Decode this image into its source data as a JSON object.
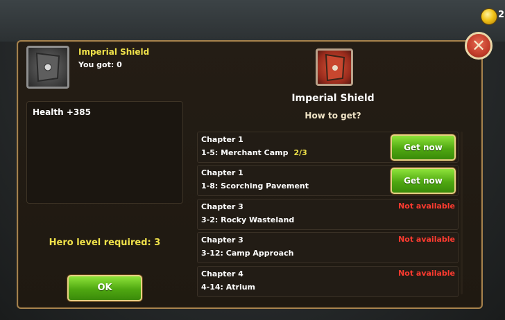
{
  "currency": {
    "amount": "2"
  },
  "item": {
    "name": "Imperial Shield",
    "you_got_label": "You got:",
    "you_got_value": "0",
    "stat": "Health +385",
    "hero_level_label": "Hero level required:",
    "hero_level_value": "3",
    "ok_label": "OK"
  },
  "detail": {
    "title": "Imperial Shield",
    "how_to_get": "How to get?"
  },
  "sources": [
    {
      "chapter": "Chapter 1",
      "level": "1-5: Merchant Camp",
      "progress": "2/3",
      "status": "Get now",
      "available": true
    },
    {
      "chapter": "Chapter 1",
      "level": "1-8: Scorching Pavement",
      "progress": "",
      "status": "Get now",
      "available": true
    },
    {
      "chapter": "Chapter 3",
      "level": "3-2: Rocky Wasteland",
      "progress": "",
      "status": "Not available",
      "available": false
    },
    {
      "chapter": "Chapter 3",
      "level": "3-12: Camp Approach",
      "progress": "",
      "status": "Not available",
      "available": false
    },
    {
      "chapter": "Chapter 4",
      "level": "4-14: Atrium",
      "progress": "",
      "status": "Not available",
      "available": false
    }
  ],
  "icons": {
    "close": "close-icon",
    "coin": "coin-icon",
    "item": "shield-icon"
  },
  "colors": {
    "accent_yellow": "#f0e24a",
    "button_green": "#4fa811",
    "not_available_red": "#ff3b30",
    "panel_border": "#a4814d"
  }
}
